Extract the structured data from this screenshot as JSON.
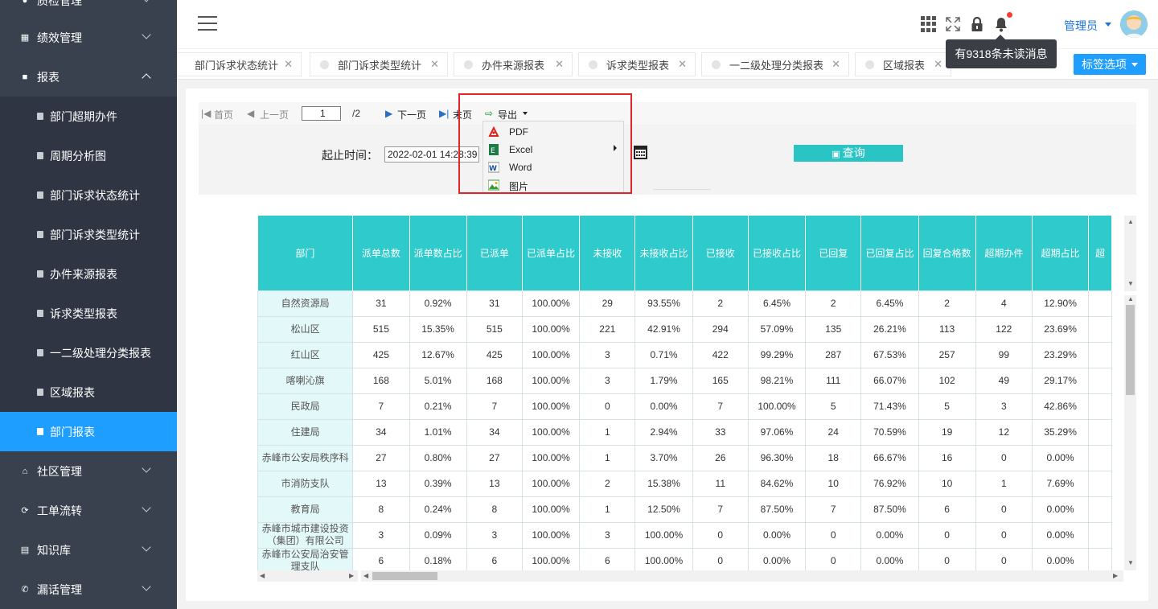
{
  "sidebar": {
    "top_partial": "质检管理",
    "groups": [
      {
        "label": "绩效管理"
      },
      {
        "label": "报表"
      },
      {
        "label": "社区管理"
      },
      {
        "label": "工单流转"
      },
      {
        "label": "知识库"
      },
      {
        "label": "漏话管理"
      }
    ],
    "report_items": [
      "部门超期办件",
      "周期分析图",
      "部门诉求状态统计",
      "部门诉求类型统计",
      "办件来源报表",
      "诉求类型报表",
      "一二级处理分类报表",
      "区域报表",
      "部门报表"
    ]
  },
  "header": {
    "user_name": "管理员",
    "tooltip": "有9318条未读消息"
  },
  "tabs": [
    "部门诉求状态统计",
    "部门诉求类型统计",
    "办件来源报表",
    "诉求类型报表",
    "一二级处理分类报表",
    "区域报表"
  ],
  "tab_options_label": "标签选项",
  "toolbar": {
    "first": "首页",
    "prev": "上一页",
    "page": "1",
    "total": "/2",
    "next": "下一页",
    "last": "末页",
    "export": "导出"
  },
  "export_menu": [
    "PDF",
    "Excel",
    "Word",
    "图片"
  ],
  "query": {
    "label": "起止时间：",
    "date_value": "2022-02-01 14:28:39",
    "button": "查询"
  },
  "table": {
    "headers": [
      "部门",
      "派单总数",
      "派单数占比",
      "已派单",
      "已派单占比",
      "未接收",
      "未接收占比",
      "已接收",
      "已接收占比",
      "已回复",
      "已回复占比",
      "回复合格数",
      "超期办件",
      "超期占比",
      "超"
    ],
    "rows": [
      [
        "自然资源局",
        "31",
        "0.92%",
        "31",
        "100.00%",
        "29",
        "93.55%",
        "2",
        "6.45%",
        "2",
        "6.45%",
        "2",
        "4",
        "12.90%",
        ""
      ],
      [
        "松山区",
        "515",
        "15.35%",
        "515",
        "100.00%",
        "221",
        "42.91%",
        "294",
        "57.09%",
        "135",
        "26.21%",
        "113",
        "122",
        "23.69%",
        ""
      ],
      [
        "红山区",
        "425",
        "12.67%",
        "425",
        "100.00%",
        "3",
        "0.71%",
        "422",
        "99.29%",
        "287",
        "67.53%",
        "257",
        "99",
        "23.29%",
        ""
      ],
      [
        "喀喇沁旗",
        "168",
        "5.01%",
        "168",
        "100.00%",
        "3",
        "1.79%",
        "165",
        "98.21%",
        "111",
        "66.07%",
        "102",
        "49",
        "29.17%",
        ""
      ],
      [
        "民政局",
        "7",
        "0.21%",
        "7",
        "100.00%",
        "0",
        "0.00%",
        "7",
        "100.00%",
        "5",
        "71.43%",
        "5",
        "3",
        "42.86%",
        ""
      ],
      [
        "住建局",
        "34",
        "1.01%",
        "34",
        "100.00%",
        "1",
        "2.94%",
        "33",
        "97.06%",
        "24",
        "70.59%",
        "19",
        "12",
        "35.29%",
        ""
      ],
      [
        "赤峰市公安局秩序科",
        "27",
        "0.80%",
        "27",
        "100.00%",
        "1",
        "3.70%",
        "26",
        "96.30%",
        "18",
        "66.67%",
        "16",
        "0",
        "0.00%",
        ""
      ],
      [
        "市消防支队",
        "13",
        "0.39%",
        "13",
        "100.00%",
        "2",
        "15.38%",
        "11",
        "84.62%",
        "10",
        "76.92%",
        "10",
        "1",
        "7.69%",
        ""
      ],
      [
        "教育局",
        "8",
        "0.24%",
        "8",
        "100.00%",
        "1",
        "12.50%",
        "7",
        "87.50%",
        "7",
        "87.50%",
        "6",
        "0",
        "0.00%",
        ""
      ],
      [
        "赤峰市城市建设投资（集团）有限公司",
        "3",
        "0.09%",
        "3",
        "100.00%",
        "3",
        "100.00%",
        "0",
        "0.00%",
        "0",
        "0.00%",
        "0",
        "0",
        "0.00%",
        ""
      ],
      [
        "赤峰市公安局治安管理支队",
        "6",
        "0.18%",
        "6",
        "100.00%",
        "6",
        "100.00%",
        "0",
        "0.00%",
        "0",
        "0.00%",
        "0",
        "0",
        "0.00%",
        ""
      ]
    ]
  }
}
